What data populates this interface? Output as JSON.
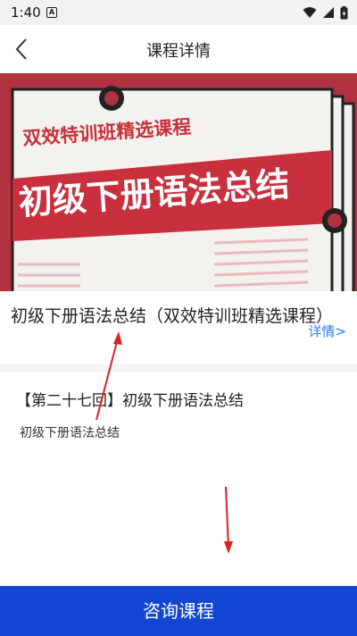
{
  "status_bar": {
    "time": "1:40",
    "notification_icon": "A"
  },
  "nav": {
    "title": "课程详情",
    "back_icon": "chevron-left-icon"
  },
  "banner": {
    "top_line": "双效特训班精选课程",
    "main_title": "初级下册语法总结",
    "colors": {
      "background": "#b0313f",
      "paper": "#f4f2ee",
      "accent": "#c8303d"
    }
  },
  "course": {
    "title": "初级下册语法总结（双效特训班精选课程）",
    "detail_link": "详情>"
  },
  "lesson": {
    "title": "【第二十七回】初级下册语法总结",
    "subtitle": "初级下册语法总结"
  },
  "footer": {
    "consult_button": "咨询课程",
    "button_color": "#1046d1"
  }
}
